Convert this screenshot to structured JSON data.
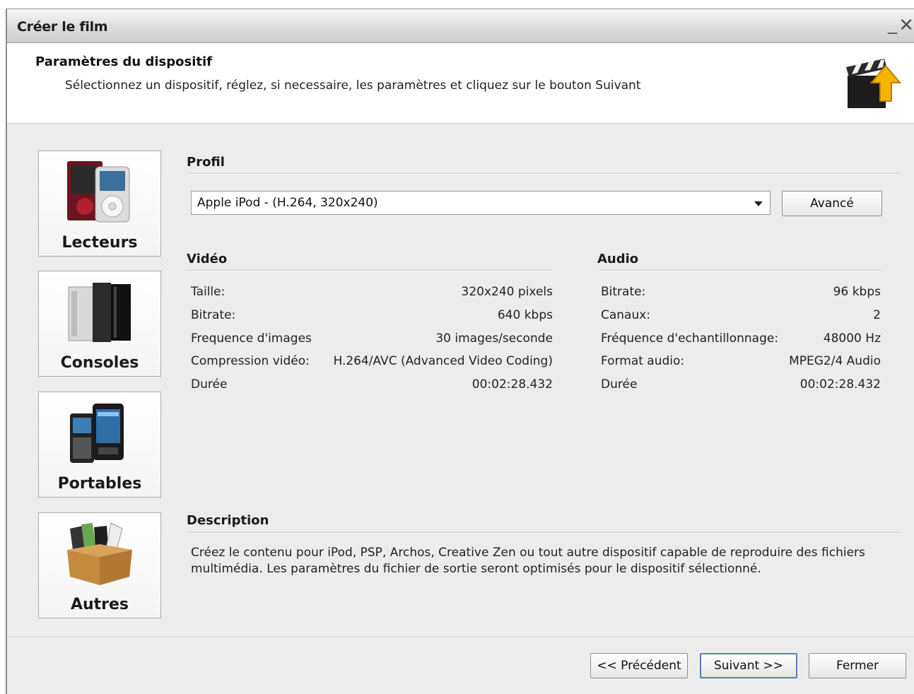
{
  "window": {
    "title": "Créer le film",
    "minimize": "_",
    "close": "✕"
  },
  "header": {
    "title": "Paramètres du dispositif",
    "subtitle": "Sélectionnez un dispositif, réglez, si necessaire, les paramètres et cliquez sur le bouton Suivant",
    "icon": "clapperboard-arrow-icon"
  },
  "categories": [
    {
      "label": "Lecteurs",
      "icon": "media-players-icon"
    },
    {
      "label": "Consoles",
      "icon": "game-consoles-icon"
    },
    {
      "label": "Portables",
      "icon": "mobile-phones-icon"
    },
    {
      "label": "Autres",
      "icon": "box-devices-icon"
    }
  ],
  "profile": {
    "heading": "Profil",
    "selected": "Apple iPod - (H.264, 320x240)",
    "advanced_label": "Avancé"
  },
  "video": {
    "heading": "Vidéo",
    "rows": [
      {
        "label": "Taille:",
        "value": "320x240 pixels"
      },
      {
        "label": "Bitrate:",
        "value": "640 kbps"
      },
      {
        "label": "Frequence d'images",
        "value": "30 images/seconde"
      },
      {
        "label": "Compression vidéo:",
        "value": "H.264/AVC (Advanced Video Coding)"
      },
      {
        "label": "Durée",
        "value": "00:02:28.432"
      }
    ]
  },
  "audio": {
    "heading": "Audio",
    "rows": [
      {
        "label": "Bitrate:",
        "value": "96 kbps"
      },
      {
        "label": "Canaux:",
        "value": "2"
      },
      {
        "label": "Fréquence d'echantillonnage:",
        "value": "48000 Hz"
      },
      {
        "label": "Format audio:",
        "value": "MPEG2/4 Audio"
      },
      {
        "label": "Durée",
        "value": "00:02:28.432"
      }
    ]
  },
  "description": {
    "heading": "Description",
    "text": "Créez le contenu pour iPod, PSP, Archos, Creative Zen ou tout autre dispositif capable de reproduire des fichiers multimédia. Les paramètres du fichier de sortie seront optimisés pour le dispositif sélectionné."
  },
  "footer": {
    "prev_label": "<< Précédent",
    "next_label": "Suivant >>",
    "close_label": "Fermer"
  }
}
